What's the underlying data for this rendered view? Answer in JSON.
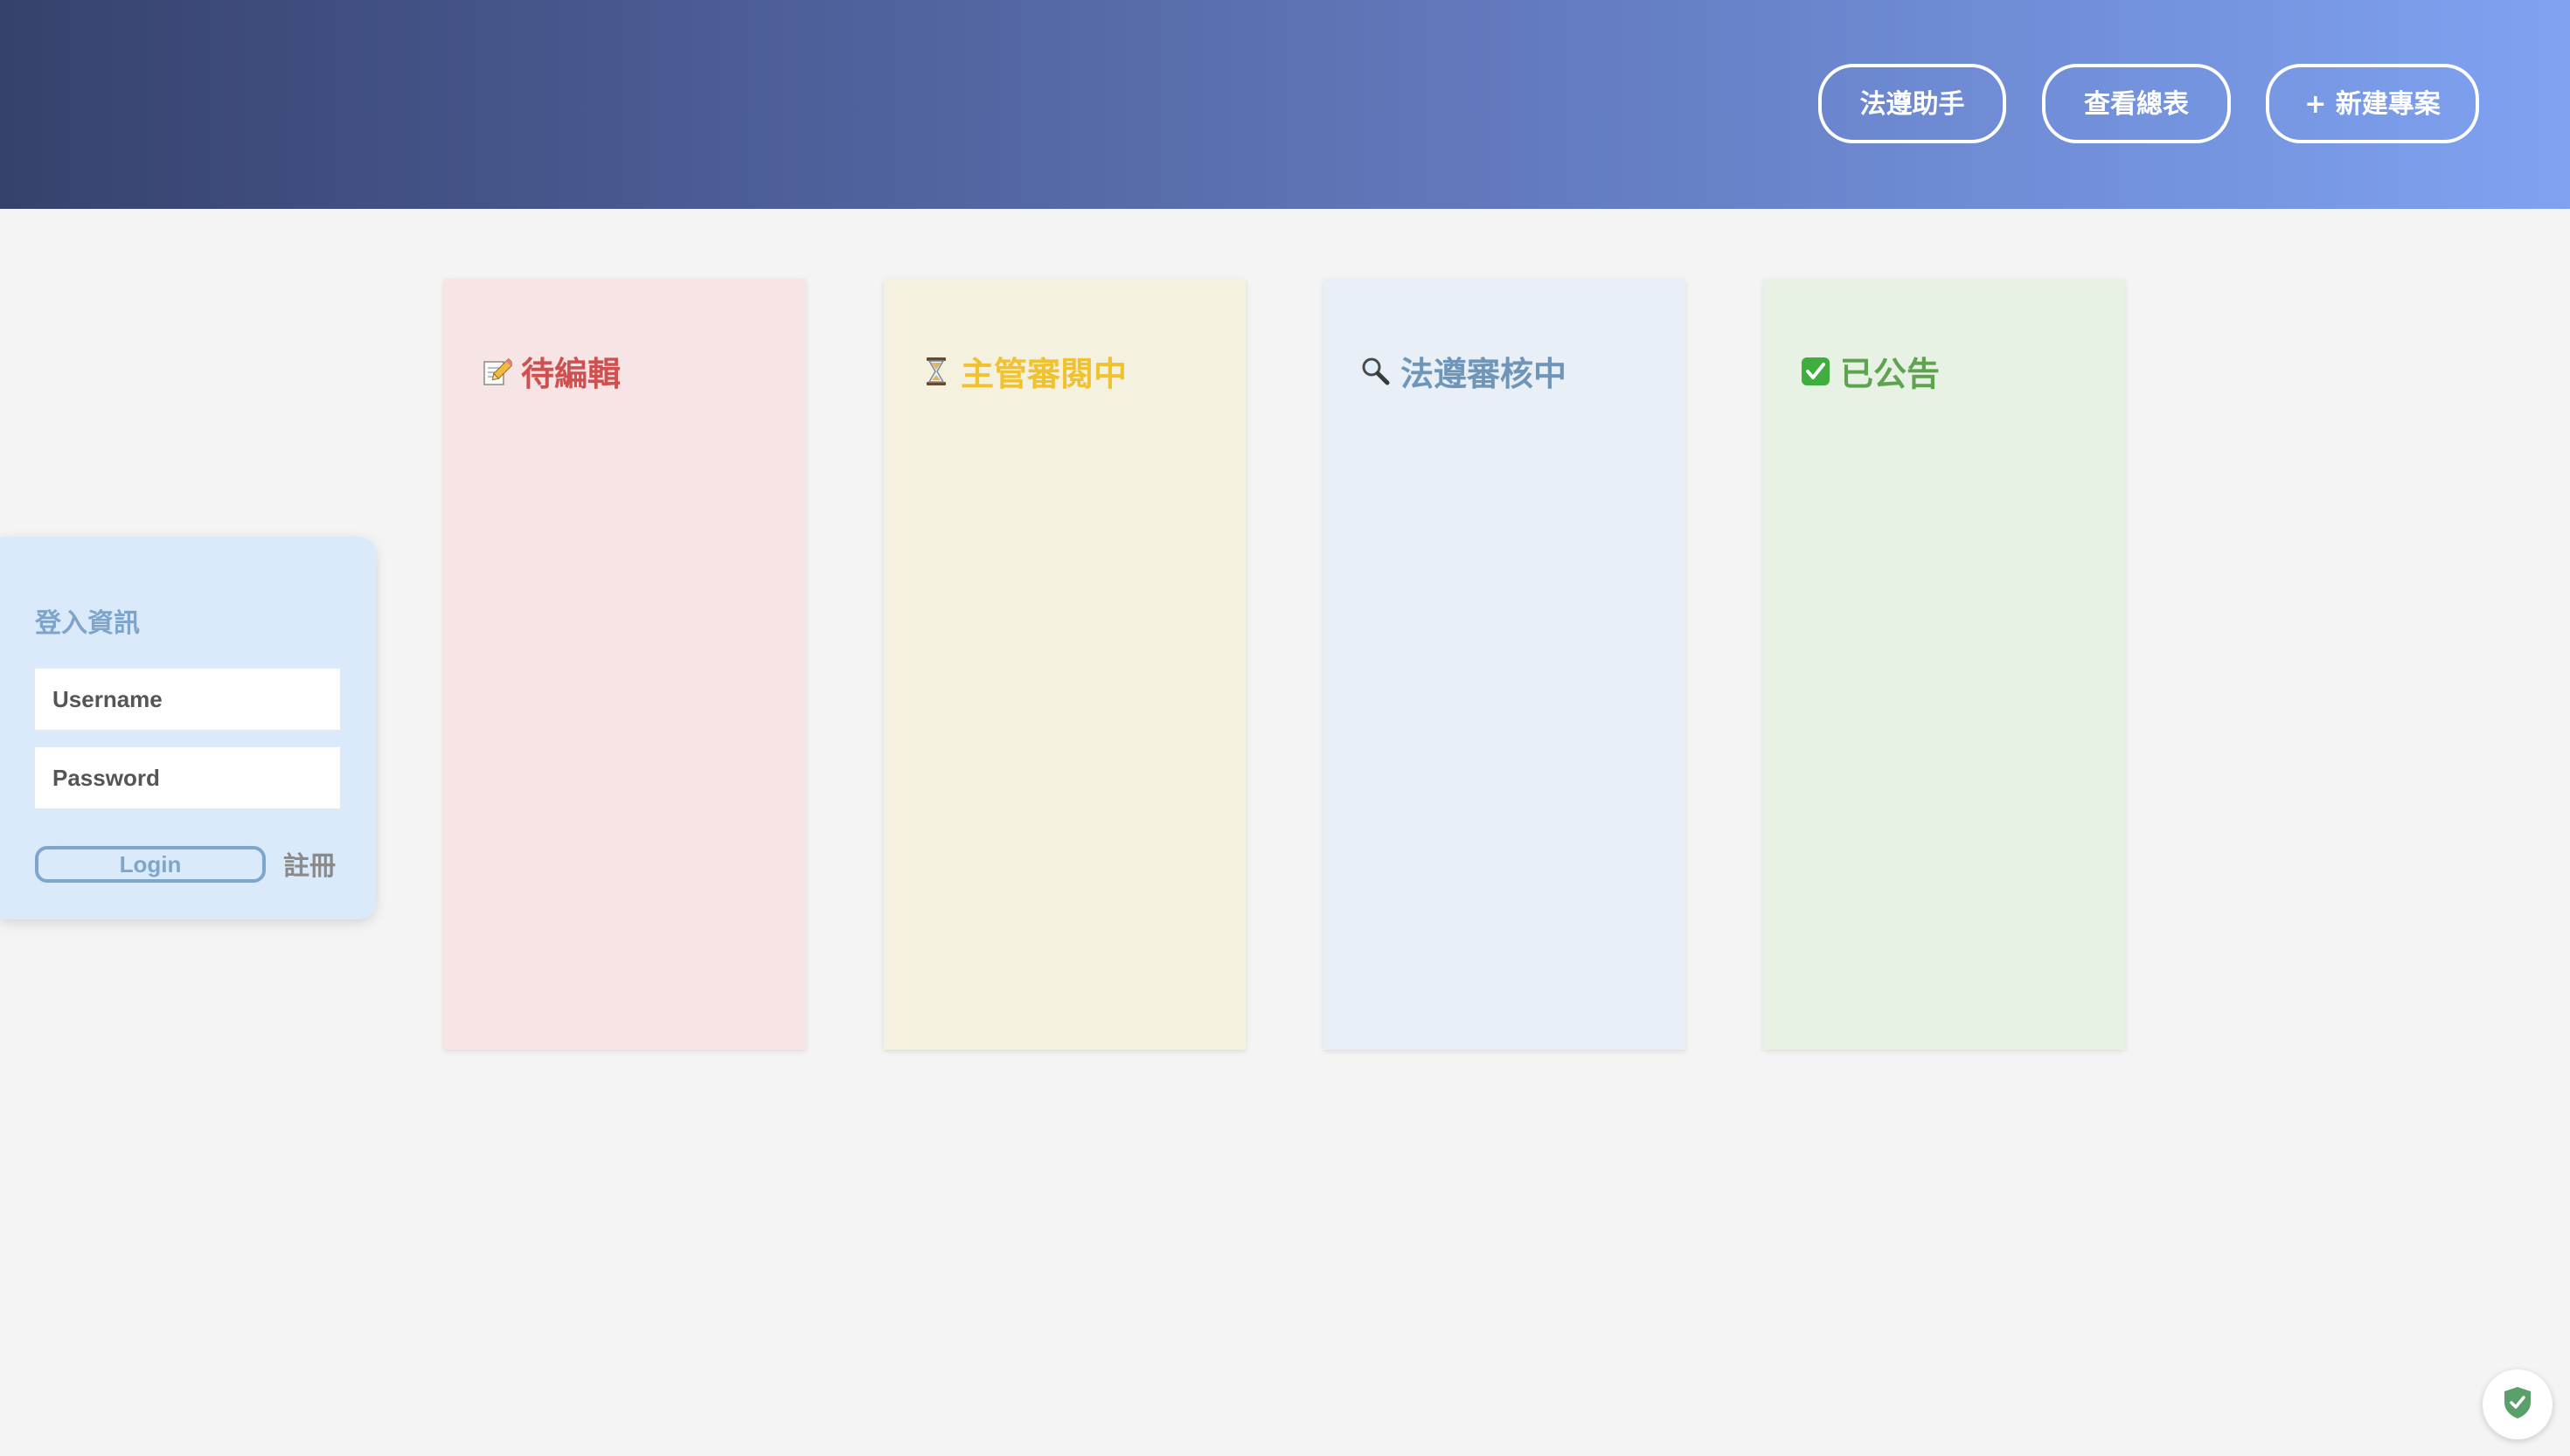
{
  "header": {
    "buttons": {
      "assistant": "法遵助手",
      "overview": "查看總表",
      "new_project": "+ 新建專案"
    }
  },
  "board": {
    "columns": [
      {
        "title": "待編輯",
        "icon": "memo-icon",
        "color": "#d0504f"
      },
      {
        "title": "主管審閱中",
        "icon": "hourglass-icon",
        "color": "#f0c22f"
      },
      {
        "title": "法遵審核中",
        "icon": "magnifier-icon",
        "color": "#6f96b8"
      },
      {
        "title": "已公告",
        "icon": "check-box-icon",
        "color": "#5ea34f"
      }
    ]
  },
  "login": {
    "title": "登入資訊",
    "username_placeholder": "Username",
    "password_placeholder": "Password",
    "login_label": "Login",
    "register_label": "註冊"
  },
  "badge": {
    "icon": "shield-check-icon"
  }
}
